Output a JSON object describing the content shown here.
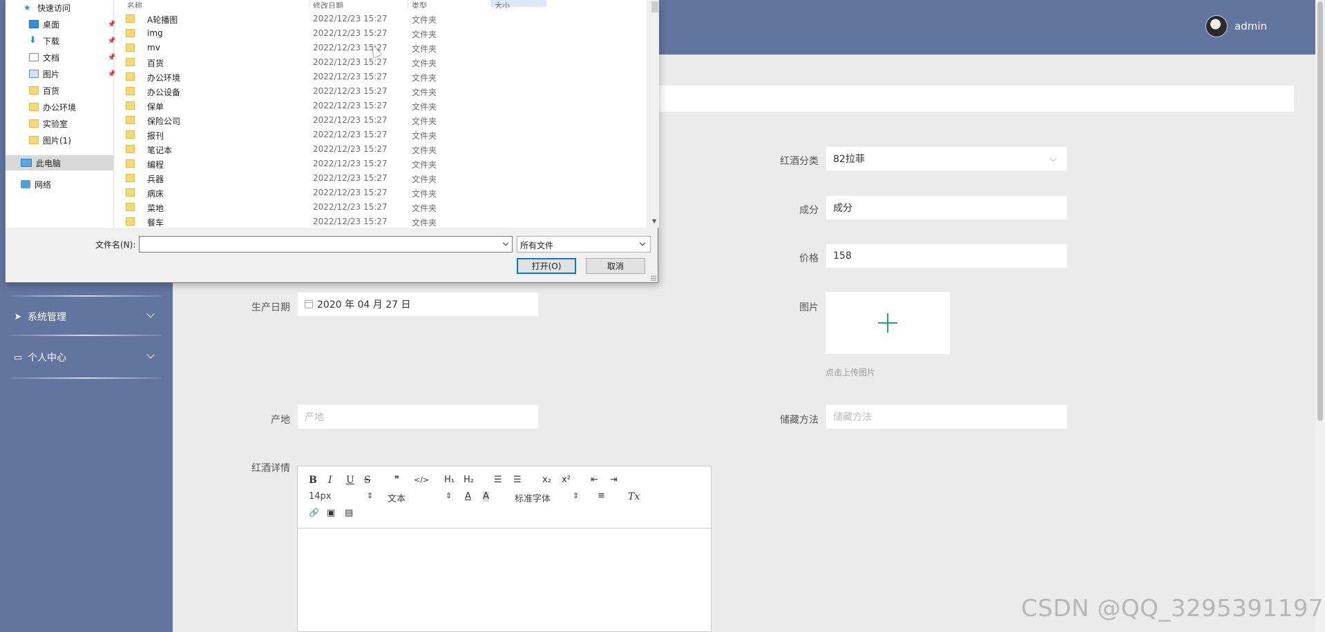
{
  "header": {
    "username": "admin"
  },
  "sidebar": {
    "items": [
      {
        "label": "系统管理",
        "icon": "send-icon"
      },
      {
        "label": "个人中心",
        "icon": "card-icon"
      }
    ]
  },
  "form": {
    "category_label": "红酒分类",
    "category_value": "82拉菲",
    "ingredient_label": "成分",
    "ingredient_value": "成分",
    "price_label": "价格",
    "price_value": "158",
    "image_label": "图片",
    "upload_tip": "点击上传图片",
    "date_label": "生产日期",
    "date_value": "2020 年 04 月 27 日",
    "origin_label": "产地",
    "origin_placeholder": "产地",
    "storage_label": "储藏方法",
    "storage_placeholder": "储藏方法",
    "detail_label": "红酒详情"
  },
  "editor": {
    "bold": "B",
    "italic": "I",
    "underline": "U",
    "strike": "S",
    "quote": "❞",
    "code": "</>",
    "h1": "H₁",
    "h2": "H₂",
    "ol": "☰",
    "ul": "☰",
    "sub": "x₂",
    "sup": "x²",
    "indent_dec": "⇤",
    "indent_inc": "⇥",
    "size": "14px",
    "format": "文本",
    "font": "标准字体",
    "color": "A",
    "bg": "A",
    "align": "≡",
    "clean": "Tx",
    "link": "🔗",
    "image": "▣",
    "video": "▤"
  },
  "watermark": "CSDN @QQ_3295391197",
  "dialog": {
    "nav": [
      {
        "label": "快速访问",
        "icon": "star-icon",
        "pinned": false
      },
      {
        "label": "桌面",
        "icon": "desktop-icon",
        "pinned": true
      },
      {
        "label": "下载",
        "icon": "download-icon",
        "pinned": true
      },
      {
        "label": "文档",
        "icon": "document-icon",
        "pinned": true
      },
      {
        "label": "图片",
        "icon": "picture-icon",
        "pinned": true
      },
      {
        "label": "百货",
        "icon": "folder-icon",
        "pinned": false
      },
      {
        "label": "办公环境",
        "icon": "folder-icon",
        "pinned": false
      },
      {
        "label": "实验室",
        "icon": "folder-icon",
        "pinned": false
      },
      {
        "label": "图片(1)",
        "icon": "folder-icon",
        "pinned": false
      },
      {
        "label": "此电脑",
        "icon": "computer-icon",
        "pinned": false
      },
      {
        "label": "网络",
        "icon": "network-icon",
        "pinned": false
      }
    ],
    "columns": [
      "名称",
      "修改日期",
      "类型",
      "大小"
    ],
    "files": [
      {
        "name": "A轮播图",
        "date": "2022/12/23 15:27",
        "type": "文件夹"
      },
      {
        "name": "img",
        "date": "2022/12/23 15:27",
        "type": "文件夹"
      },
      {
        "name": "mv",
        "date": "2022/12/23 15:27",
        "type": "文件夹"
      },
      {
        "name": "百货",
        "date": "2022/12/23 15:27",
        "type": "文件夹"
      },
      {
        "name": "办公环境",
        "date": "2022/12/23 15:27",
        "type": "文件夹"
      },
      {
        "name": "办公设备",
        "date": "2022/12/23 15:27",
        "type": "文件夹"
      },
      {
        "name": "保单",
        "date": "2022/12/23 15:27",
        "type": "文件夹"
      },
      {
        "name": "保险公司",
        "date": "2022/12/23 15:27",
        "type": "文件夹"
      },
      {
        "name": "报刊",
        "date": "2022/12/23 15:27",
        "type": "文件夹"
      },
      {
        "name": "笔记本",
        "date": "2022/12/23 15:27",
        "type": "文件夹"
      },
      {
        "name": "编程",
        "date": "2022/12/23 15:27",
        "type": "文件夹"
      },
      {
        "name": "兵器",
        "date": "2022/12/23 15:27",
        "type": "文件夹"
      },
      {
        "name": "病床",
        "date": "2022/12/23 15:27",
        "type": "文件夹"
      },
      {
        "name": "菜地",
        "date": "2022/12/23 15:27",
        "type": "文件夹"
      },
      {
        "name": "餐车",
        "date": "2022/12/23 15:27",
        "type": "文件夹"
      }
    ],
    "filename_label": "文件名(N):",
    "filename_value": "",
    "filter_value": "所有文件",
    "open_button": "打开(O)",
    "cancel_button": "取消"
  }
}
